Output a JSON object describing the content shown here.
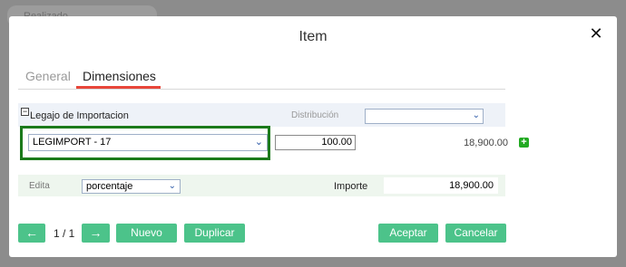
{
  "backdrop": {
    "label": "Realizado"
  },
  "modal": {
    "title": "Item",
    "close": "✕"
  },
  "tabs": [
    {
      "label": "General"
    },
    {
      "label": "Dimensiones"
    }
  ],
  "dimension": {
    "collapse_glyph": "−",
    "group_label": "Legajo de Importacion",
    "distribution_label": "Distribución",
    "distribution_value": "",
    "row": {
      "selected": "LEGIMPORT - 17",
      "percent": "100.00",
      "amount": "18,900.00"
    },
    "add_glyph": "+"
  },
  "footer": {
    "edit_label": "Edita",
    "mode_value": "porcentaje",
    "importe_label": "Importe",
    "importe_value": "18,900.00"
  },
  "pager": {
    "indicator": "1 / 1",
    "prev": "←",
    "next": "→"
  },
  "buttons": {
    "nuevo": "Nuevo",
    "duplicar": "Duplicar",
    "aceptar": "Aceptar",
    "cancelar": "Cancelar"
  },
  "icons": {
    "chevron": "⌄",
    "prev": "arrow-left-icon",
    "next": "arrow-right-icon",
    "add": "plus-icon",
    "close": "close-icon"
  },
  "colors": {
    "accent_green": "#4cc38a",
    "highlight": "#1b7a1b",
    "tab_underline": "#e8463a",
    "add_green": "#22aa22"
  }
}
